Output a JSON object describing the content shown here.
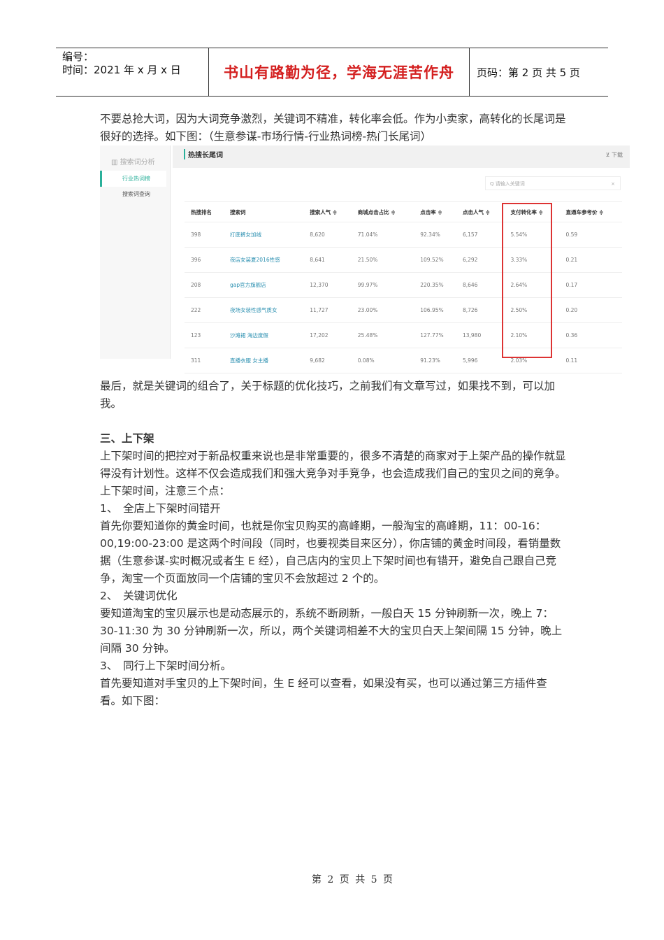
{
  "header": {
    "number_label": "编号：",
    "date_label": "时间：2021 年 x 月 x 日",
    "motto": "书山有路勤为径，学海无涯苦作舟",
    "page_label": "页码：第 2 页 共 5 页"
  },
  "intro": "不要总抢大词，因为大词竞争激烈，关键词不精准，转化率会低。作为小卖家，高转化的长尾词是很好的选择。如下图：（生意参谋-市场行情-行业热词榜-热门长尾词）",
  "screenshot": {
    "sidebar": {
      "title": "搜索词分析",
      "active": "行业热词榜",
      "item": "搜索词查询"
    },
    "section_title": "热搜长尾词",
    "download": "⊻ 下载",
    "search_placeholder": "Q 请输入关键词",
    "clear": "×",
    "columns": [
      "热搜排名",
      "搜索词",
      "搜索人气 ≑",
      "商城点击占比 ≑",
      "点击率 ≑",
      "点击人气 ≑",
      "支付转化率 ≑",
      "直通车参考价 ≑"
    ],
    "rows": [
      [
        "398",
        "打底裤女加绒",
        "8,620",
        "71.04%",
        "92.34%",
        "6,157",
        "5.54%",
        "0.59"
      ],
      [
        "396",
        "夜店女装夏2016性感",
        "8,641",
        "21.50%",
        "109.52%",
        "6,292",
        "3.33%",
        "0.21"
      ],
      [
        "208",
        "gap官方旗舰店",
        "12,370",
        "99.97%",
        "220.35%",
        "8,646",
        "2.64%",
        "0.17"
      ],
      [
        "222",
        "夜场女装性感气质女",
        "11,727",
        "23.00%",
        "106.95%",
        "8,726",
        "2.50%",
        "0.20"
      ],
      [
        "123",
        "沙滩裙 海边度假",
        "17,202",
        "25.48%",
        "127.77%",
        "13,980",
        "2.10%",
        "0.36"
      ],
      [
        "311",
        "直播衣服 女主播",
        "9,682",
        "0.08%",
        "91.23%",
        "5,996",
        "2.03%",
        "0.11"
      ]
    ]
  },
  "after": "最后，就是关键词的组合了，关于标题的优化技巧，之前我们有文章写过，如果找不到，可以加我。",
  "section3": {
    "heading": "三、上下架",
    "paras": [
      "上下架时间的把控对于新品权重来说也是非常重要的，很多不清楚的商家对于上架产品的操作就显得没有计划性。这样不仅会造成我们和强大竞争对手竞争，也会造成我们自己的宝贝之间的竞争。",
      "上下架时间，注意三个点：",
      "1、　全店上下架时间错开",
      "首先你要知道你的黄金时间，也就是你宝贝购买的高峰期，一般淘宝的高峰期，11：00-16：00,19:00-23:00 是这两个时间段（同时，也要视类目来区分），你店铺的黄金时间段，看销量数据（生意参谋-实时概况或者生 E 经），自己店内的宝贝上下架时间也有错开，避免自己跟自己竞争，淘宝一个页面放同一个店铺的宝贝不会放超过 2 个的。",
      "2、　关键词优化",
      "要知道淘宝的宝贝展示也是动态展示的，系统不断刷新，一般白天 15 分钟刷新一次，晚上 7：30-11:30 为 30 分钟刷新一次，所以，两个关键词相差不大的宝贝白天上架间隔 15 分钟，晚上间隔 30 分钟。",
      "3、　同行上下架时间分析。",
      "首先要知道对手宝贝的上下架时间，生 E 经可以查看，如果没有买，也可以通过第三方插件查看。如下图："
    ]
  },
  "footer": "第 2 页 共 5 页"
}
